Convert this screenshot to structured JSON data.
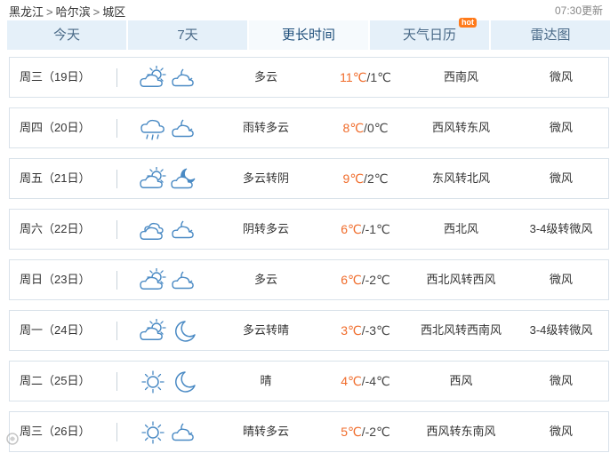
{
  "breadcrumb": {
    "province": "黑龙江",
    "city": "哈尔滨",
    "district": "城区",
    "separator": ">"
  },
  "update_time": "07:30更新",
  "tabs": [
    {
      "label": "今天",
      "active": false
    },
    {
      "label": "7天",
      "active": false
    },
    {
      "label": "更长时间",
      "active": true
    },
    {
      "label": "天气日历",
      "active": false,
      "badge": "hot"
    },
    {
      "label": "雷达图",
      "active": false
    }
  ],
  "days": [
    {
      "day": "周三（19日）",
      "icon_day": "partly-cloudy-icon",
      "icon_night": "cloudy-night-icon",
      "condition": "多云",
      "high": "11℃",
      "low": "1℃",
      "wind_dir": "西南风",
      "wind_level": "微风"
    },
    {
      "day": "周四（20日）",
      "icon_day": "rain-icon",
      "icon_night": "cloudy-night-icon",
      "condition": "雨转多云",
      "high": "8℃",
      "low": "0℃",
      "wind_dir": "西风转东风",
      "wind_level": "微风"
    },
    {
      "day": "周五（21日）",
      "icon_day": "partly-cloudy-icon",
      "icon_night": "moon-cloud-icon",
      "condition": "多云转阴",
      "high": "9℃",
      "low": "2℃",
      "wind_dir": "东风转北风",
      "wind_level": "微风"
    },
    {
      "day": "周六（22日）",
      "icon_day": "overcast-icon",
      "icon_night": "cloudy-night-icon",
      "condition": "阴转多云",
      "high": "6℃",
      "low": "-1℃",
      "wind_dir": "西北风",
      "wind_level": "3-4级转微风"
    },
    {
      "day": "周日（23日）",
      "icon_day": "partly-cloudy-icon",
      "icon_night": "cloudy-night-icon",
      "condition": "多云",
      "high": "6℃",
      "low": "-2℃",
      "wind_dir": "西北风转西风",
      "wind_level": "微风"
    },
    {
      "day": "周一（24日）",
      "icon_day": "partly-cloudy-icon",
      "icon_night": "moon-icon",
      "condition": "多云转晴",
      "high": "3℃",
      "low": "-3℃",
      "wind_dir": "西北风转西南风",
      "wind_level": "3-4级转微风"
    },
    {
      "day": "周二（25日）",
      "icon_day": "sun-icon",
      "icon_night": "moon-icon",
      "condition": "晴",
      "high": "4℃",
      "low": "-4℃",
      "wind_dir": "西风",
      "wind_level": "微风"
    },
    {
      "day": "周三（26日）",
      "icon_day": "sun-icon",
      "icon_night": "cloudy-night-icon",
      "condition": "晴转多云",
      "high": "5℃",
      "low": "-2℃",
      "wind_dir": "西风转东南风",
      "wind_level": "微风"
    }
  ],
  "colors": {
    "accent": "#f06b2a",
    "tab_bg": "#e5f0f9",
    "icon": "#4a8ac4"
  }
}
